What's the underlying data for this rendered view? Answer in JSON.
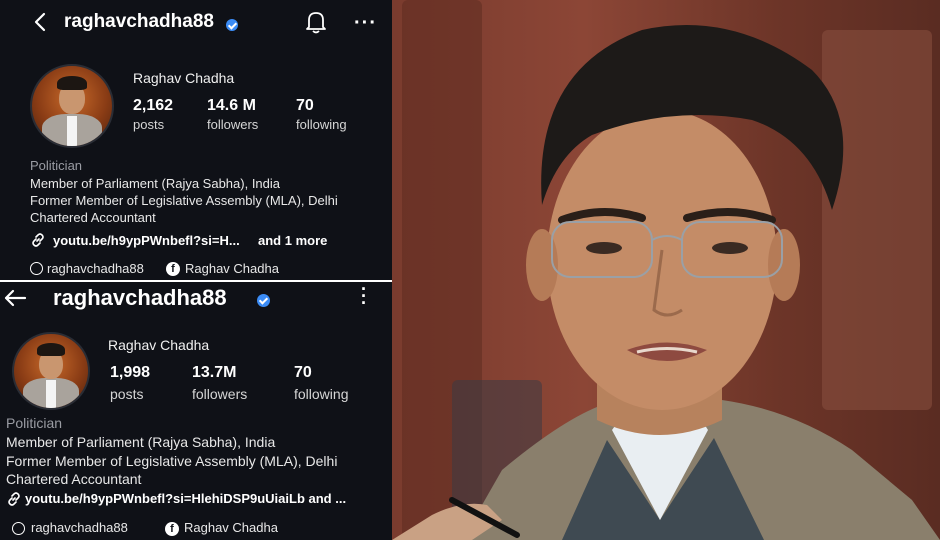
{
  "top_profile": {
    "username": "raghavchadha88",
    "display_name": "Raghav Chadha",
    "stats": [
      {
        "value": "2,162",
        "label": "posts"
      },
      {
        "value": "14.6 M",
        "label": "followers"
      },
      {
        "value": "70",
        "label": "following"
      }
    ],
    "category": "Politician",
    "bio_lines": [
      "Member of Parliament (Rajya Sabha), India",
      "Former Member of Legislative Assembly (MLA), Delhi",
      "Chartered Accountant"
    ],
    "link_text": "youtu.be/h9ypPWnbefl?si=H...",
    "link_more": "and 1 more",
    "threads_handle": "raghavchadha88",
    "facebook_name": "Raghav Chadha"
  },
  "bottom_profile": {
    "username": "raghavchadha88",
    "display_name": "Raghav Chadha",
    "stats": [
      {
        "value": "1,998",
        "label": "posts"
      },
      {
        "value": "13.7M",
        "label": "followers"
      },
      {
        "value": "70",
        "label": "following"
      }
    ],
    "category": "Politician",
    "bio_lines": [
      "Member of Parliament (Rajya Sabha), India",
      "Former Member of Legislative Assembly (MLA), Delhi",
      "Chartered Accountant"
    ],
    "link_text": "youtu.be/h9ypPWnbefl?si=HlehiDSP9uUiaiLb and ...",
    "threads_handle": "raghavchadha88",
    "facebook_name": "Raghav Chadha"
  },
  "icons": {
    "back": "back-arrow-icon",
    "notification": "bell-icon",
    "more": "more-options-icon",
    "verified": "verified-badge-icon",
    "link": "link-icon",
    "threads": "threads-icon",
    "facebook": "facebook-icon"
  },
  "colors": {
    "panel_bg": "#0f1117",
    "verified": "#3b8cf6"
  }
}
